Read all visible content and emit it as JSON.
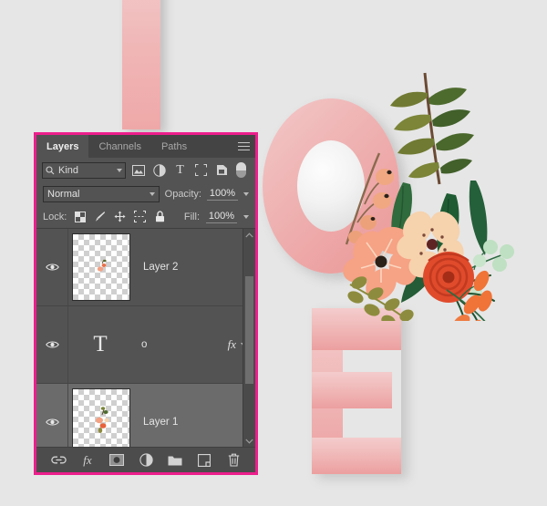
{
  "canvas": {
    "background_color": "#e6e6e6",
    "artwork": {
      "description": "Pink gradient letters with floral bouquet",
      "letters": [
        {
          "char": "L",
          "color": "#efb0b0",
          "name": "letter-l"
        },
        {
          "char": "O",
          "color": "#eeb0b0",
          "name": "letter-o"
        },
        {
          "char": "E",
          "color": "#efb4b4",
          "name": "letter-e"
        }
      ],
      "bouquet_name": "floral-bouquet"
    }
  },
  "panel": {
    "border_color": "#ec1e8c",
    "background_color": "#535353",
    "tabs": [
      {
        "label": "Layers",
        "active": true
      },
      {
        "label": "Channels",
        "active": false
      },
      {
        "label": "Paths",
        "active": false
      }
    ],
    "menu_icon": "hamburger-menu-icon",
    "filter": {
      "kind_label": "Kind",
      "search_icon": "search-icon",
      "icons": [
        "pixel-layer-filter-icon",
        "adjustment-layer-filter-icon",
        "type-layer-filter-icon",
        "shape-layer-filter-icon",
        "smart-object-filter-icon"
      ],
      "toggle_name": "filter-enable-toggle"
    },
    "blend": {
      "mode": "Normal",
      "opacity_label": "Opacity:",
      "opacity_value": "100%"
    },
    "lock": {
      "label": "Lock:",
      "icons": [
        "lock-transparent-pixels-icon",
        "lock-image-pixels-icon",
        "lock-position-icon",
        "lock-artboard-nesting-icon",
        "lock-all-icon"
      ],
      "fill_label": "Fill:",
      "fill_value": "100%"
    },
    "layers": [
      {
        "name": "Layer 2",
        "visible": true,
        "thumb_type": "transparent",
        "selected": false,
        "has_fx": false
      },
      {
        "name": "o",
        "visible": true,
        "thumb_type": "text",
        "thumb_glyph": "T",
        "selected": false,
        "has_fx": true,
        "fx_label": "fx"
      },
      {
        "name": "Layer 1",
        "visible": true,
        "thumb_type": "transparent",
        "selected": true,
        "has_fx": false
      }
    ],
    "scrollbar": {
      "up_arrow": "scroll-up-arrow-icon",
      "down_arrow": "scroll-down-arrow-icon"
    },
    "bottom_toolbar": [
      {
        "icon": "link-layers-icon",
        "label": ""
      },
      {
        "icon": "layer-style-fx-icon",
        "label": "fx"
      },
      {
        "icon": "add-layer-mask-icon",
        "label": ""
      },
      {
        "icon": "new-adjustment-layer-icon",
        "label": ""
      },
      {
        "icon": "new-group-icon",
        "label": ""
      },
      {
        "icon": "new-layer-icon",
        "label": ""
      },
      {
        "icon": "delete-layer-icon",
        "label": ""
      }
    ]
  }
}
